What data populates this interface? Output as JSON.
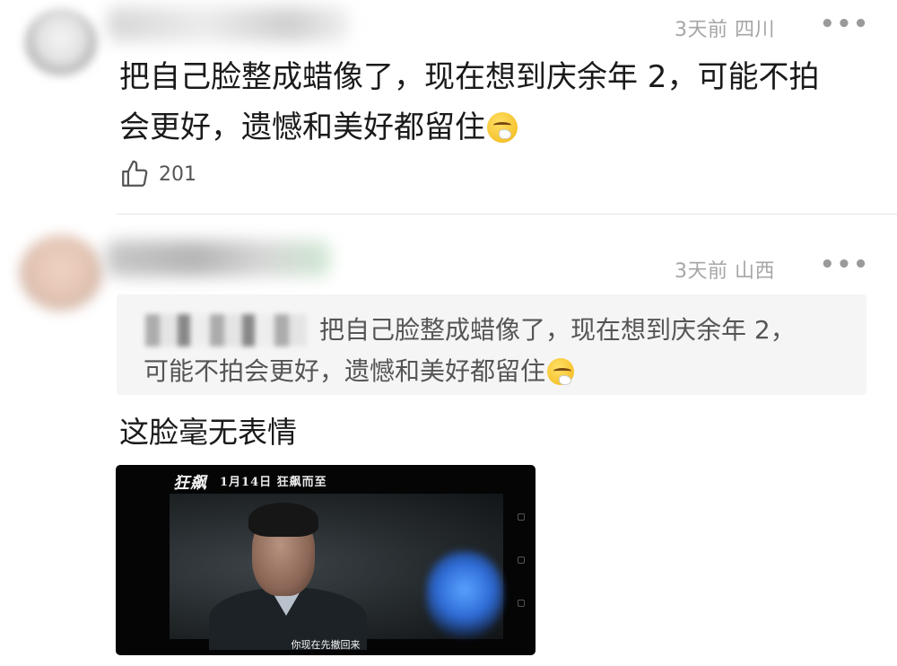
{
  "comments": [
    {
      "meta": "3天前 四川",
      "more": "•••",
      "text_line1": "把自己脸整成蜡像了，现在想到庆余年 2，可能不拍",
      "text_line2": "会更好，遗憾和美好都留住",
      "emoji": "sneezing-face-emoji",
      "likes": "201"
    },
    {
      "meta": "3天前 山西",
      "more": "•••",
      "quote_line1": "把自己脸整成蜡像了，现在想到庆余年 2，",
      "quote_line2": "可能不拍会更好，遗憾和美好都留住",
      "text": "这脸毫无表情",
      "video": {
        "logo": "狂飙",
        "topline": "1月14日  狂飙而至",
        "subtitle": "你现在先撤回来"
      }
    }
  ],
  "colors": {
    "text": "#1a1a1a",
    "meta": "#a6a6a6",
    "quote_bg": "#f5f5f5"
  }
}
